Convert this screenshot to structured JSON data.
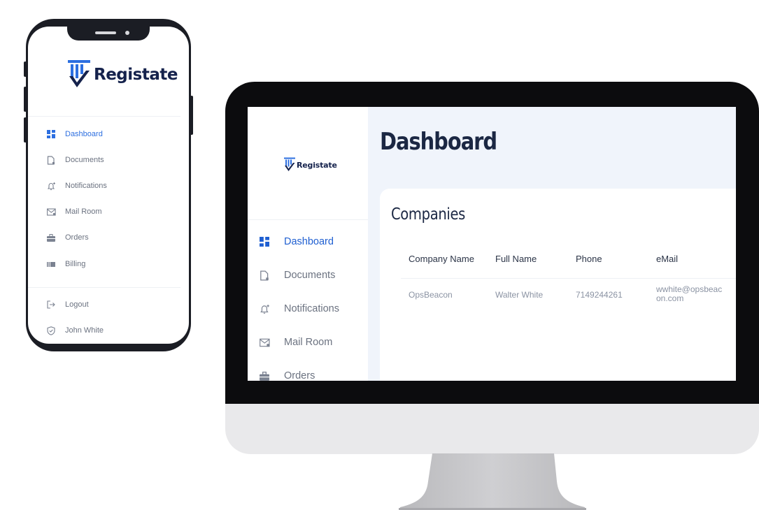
{
  "brand": {
    "name": "Registate",
    "color": "#15224c",
    "accent": "#2d6fe0"
  },
  "phone": {
    "menu": [
      {
        "label": "Dashboard",
        "icon": "dashboard-icon",
        "active": true
      },
      {
        "label": "Documents",
        "icon": "document-icon"
      },
      {
        "label": "Notifications",
        "icon": "bell-icon"
      },
      {
        "label": "Mail Room",
        "icon": "mail-icon"
      },
      {
        "label": "Orders",
        "icon": "briefcase-icon"
      },
      {
        "label": "Billing",
        "icon": "billing-icon"
      }
    ],
    "footer": [
      {
        "label": "Logout",
        "icon": "logout-icon"
      },
      {
        "label": "John White",
        "icon": "shield-check-icon"
      }
    ]
  },
  "desktop": {
    "page_title": "Dashboard",
    "menu": [
      {
        "label": "Dashboard",
        "icon": "dashboard-icon",
        "active": true
      },
      {
        "label": "Documents",
        "icon": "document-icon"
      },
      {
        "label": "Notifications",
        "icon": "bell-icon"
      },
      {
        "label": "Mail Room",
        "icon": "mail-icon"
      },
      {
        "label": "Orders",
        "icon": "briefcase-icon"
      }
    ],
    "companies": {
      "title": "Companies",
      "columns": [
        "Company Name",
        "Full Name",
        "Phone",
        "eMail"
      ],
      "rows": [
        [
          "OpsBeacon",
          "Walter White",
          "7149244261",
          "wwhite@opsbeacon.com"
        ]
      ]
    }
  }
}
